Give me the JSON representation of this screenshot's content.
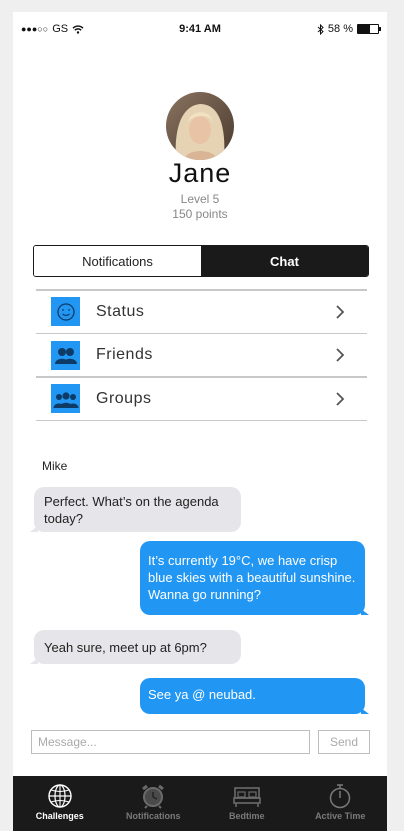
{
  "status_bar": {
    "signal": "●●●○○",
    "carrier": "GS",
    "time": "9:41 AM",
    "battery": "58 %",
    "battery_level": 0.58
  },
  "profile": {
    "name": "Jane",
    "level": "Level 5",
    "points": "150 points"
  },
  "segmented": {
    "notifications": "Notifications",
    "chat": "Chat",
    "selected": "Chat"
  },
  "menu": {
    "items": [
      {
        "label": "Status",
        "icon": "smiley-icon"
      },
      {
        "label": "Friends",
        "icon": "friends-icon"
      },
      {
        "label": "Groups",
        "icon": "groups-icon"
      }
    ]
  },
  "chat": {
    "sender": "Mike",
    "messages": [
      {
        "from": "Mike",
        "direction": "incoming",
        "text": "Perfect. What’s on the agenda today?"
      },
      {
        "from": "Jane",
        "direction": "outgoing",
        "text": "It’s currently 19°C, we have crisp blue skies with a beautiful sunshine. Wanna go running?"
      },
      {
        "from": "Mike",
        "direction": "incoming",
        "text": "Yeah sure, meet up at 6pm?"
      },
      {
        "from": "Jane",
        "direction": "outgoing",
        "text": "See ya @ neubad."
      }
    ],
    "input_placeholder": "Message...",
    "input_value": "",
    "send_label": "Send"
  },
  "tabbar": {
    "items": [
      {
        "label": "Challenges",
        "icon": "globe-icon",
        "active": true
      },
      {
        "label": "Notifications",
        "icon": "alarm-clock-icon",
        "active": false
      },
      {
        "label": "Bedtime",
        "icon": "bed-icon",
        "active": false
      },
      {
        "label": "Active Time",
        "icon": "stopwatch-icon",
        "active": false
      }
    ]
  },
  "colors": {
    "accent": "#2196f3",
    "dark": "#1a1a1a",
    "incoming_bubble": "#e6e6ea"
  }
}
